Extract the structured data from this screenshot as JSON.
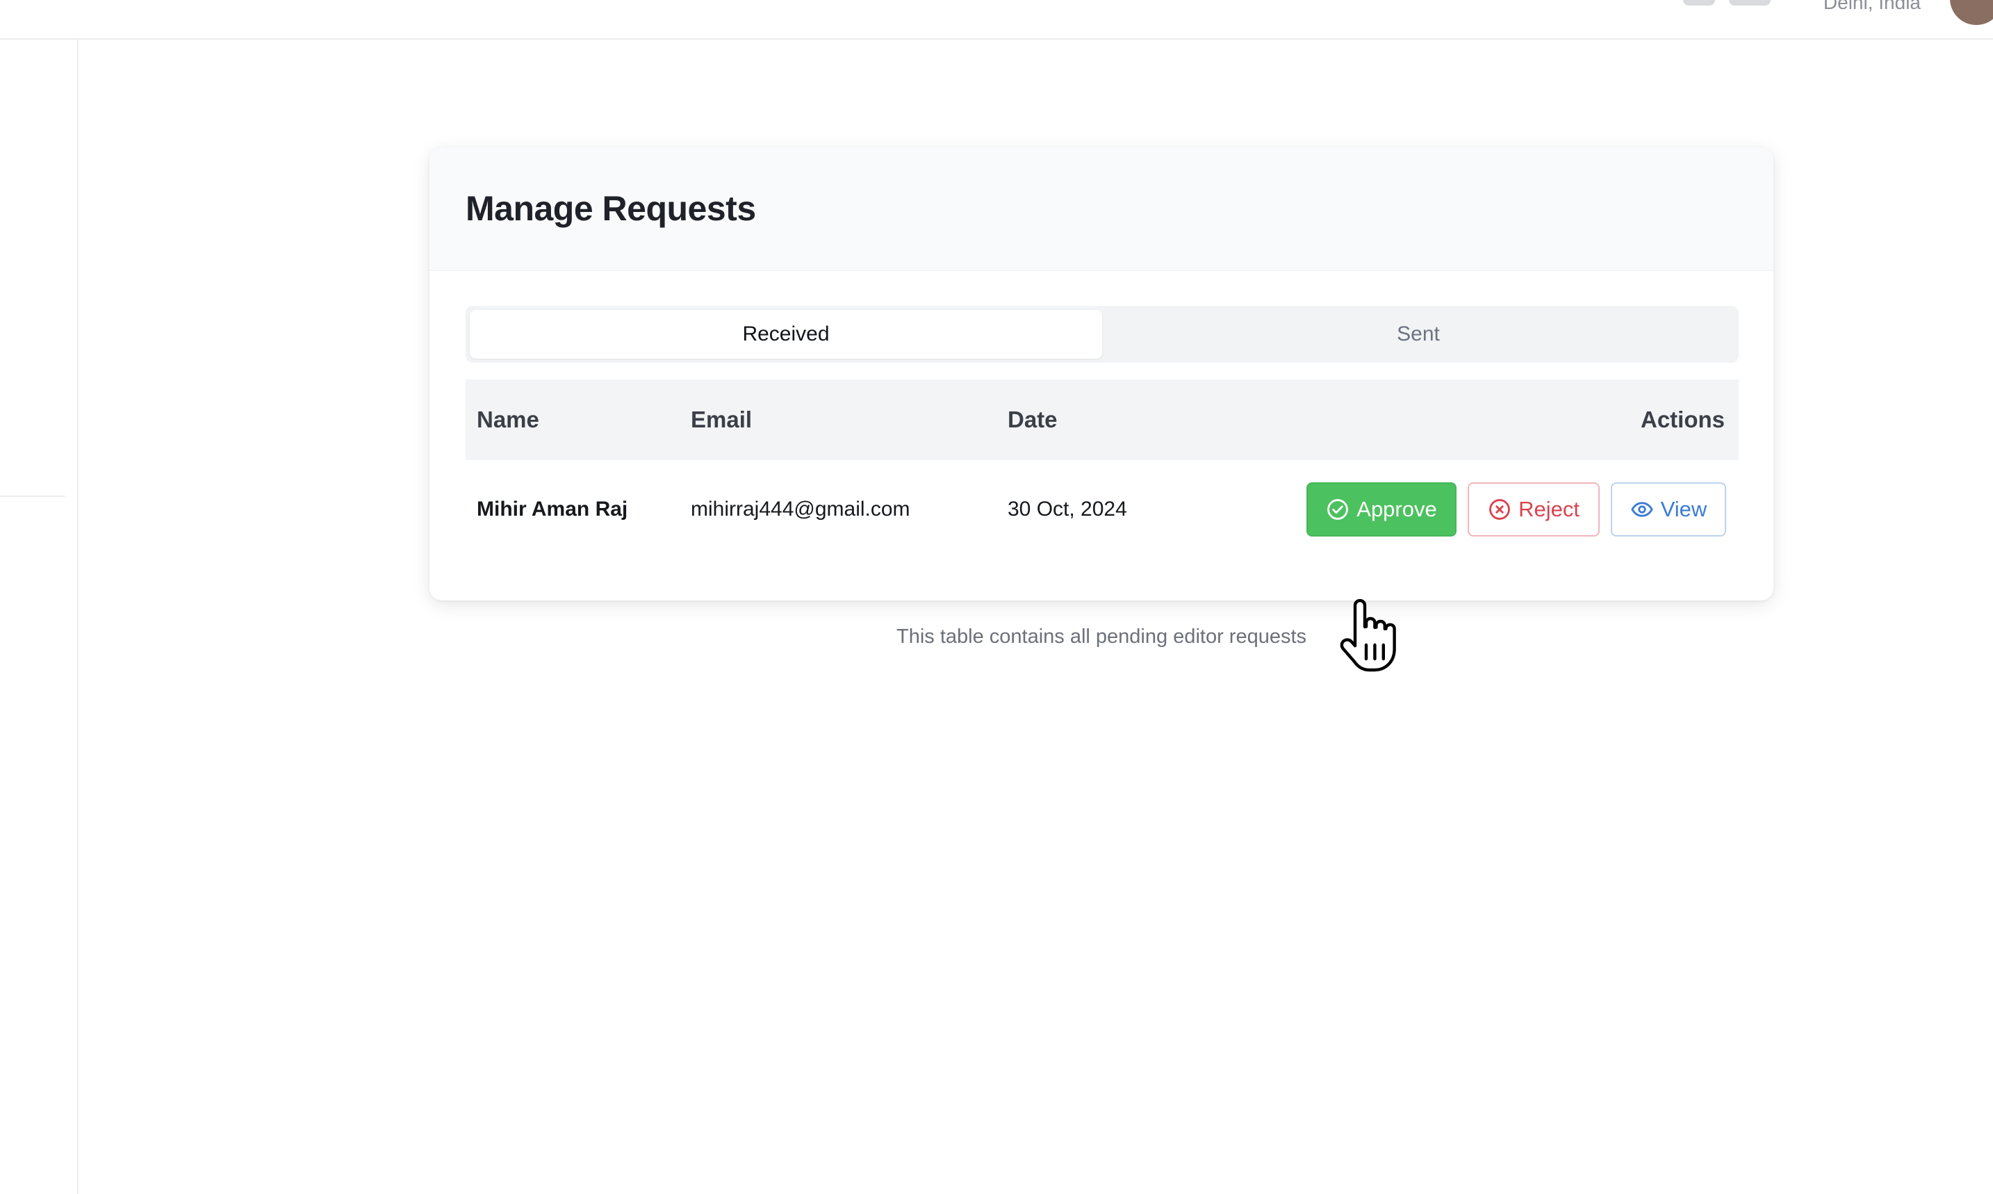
{
  "topbar": {
    "location": "Delhi, India"
  },
  "card": {
    "title": "Manage Requests",
    "tabs": [
      {
        "label": "Received",
        "active": true
      },
      {
        "label": "Sent",
        "active": false
      }
    ],
    "table": {
      "columns": [
        "Name",
        "Email",
        "Date",
        "Actions"
      ],
      "rows": [
        {
          "name": "Mihir Aman Raj",
          "email": "mihirraj444@gmail.com",
          "date": "30 Oct, 2024"
        }
      ]
    },
    "actions": {
      "approve": "Approve",
      "reject": "Reject",
      "view": "View"
    }
  },
  "caption": "This table contains all pending editor requests",
  "colors": {
    "approve": "#4cc15f",
    "reject": "#d9434e",
    "view": "#3a7bd5"
  },
  "icons": {
    "approve": "check-circle-icon",
    "reject": "x-circle-icon",
    "view": "eye-icon",
    "cursor": "hand-pointer-cursor"
  }
}
